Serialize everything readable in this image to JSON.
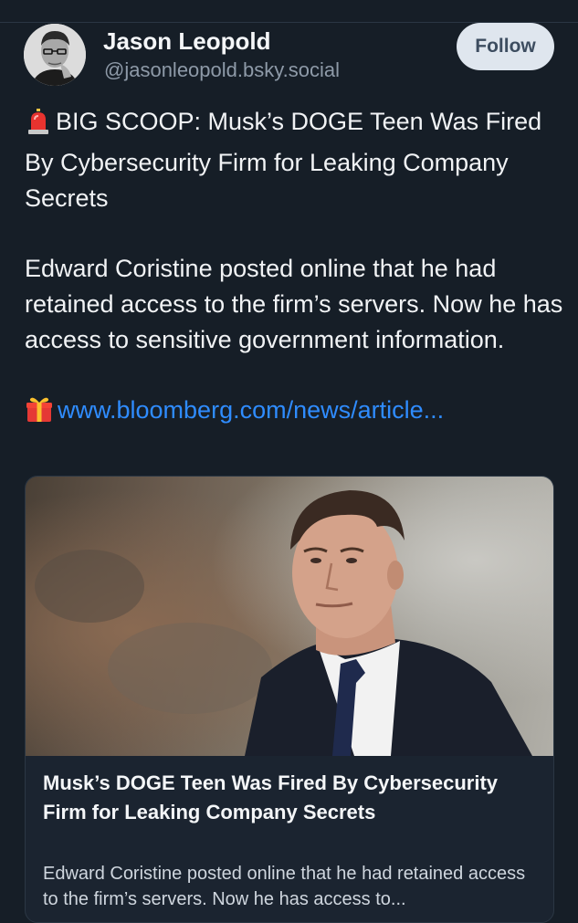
{
  "author": {
    "name": "Jason Leopold",
    "handle": "@jasonleopold.bsky.social"
  },
  "follow_label": "Follow",
  "post": {
    "headline": "BIG SCOOP: Musk’s DOGE Teen Was Fired By Cybersecurity Firm for Leaking Company Secrets",
    "body": "Edward Coristine posted online that he had retained access to the firm’s servers. Now he has access to sensitive government information.",
    "link_text": "www.bloomberg.com/news/article..."
  },
  "card": {
    "title": "Musk’s DOGE Teen Was Fired By Cybersecurity Firm for Leaking Company Secrets",
    "description": "Edward Coristine posted online that he had retained access to the firm’s servers. Now he has access to..."
  },
  "icons": {
    "headline_emoji": "siren-icon",
    "link_emoji": "gift-icon"
  },
  "colors": {
    "background": "#161e27",
    "link": "#2f8cff",
    "follow_button": "#dfe6ee",
    "handle": "#8e9aa8"
  }
}
